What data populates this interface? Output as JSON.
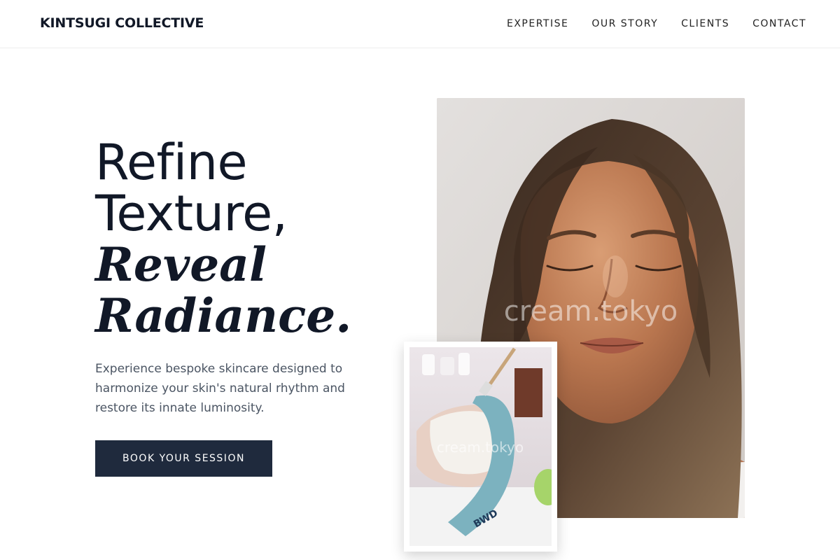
{
  "brand": "KINTSUGI COLLECTIVE",
  "nav": [
    "EXPERTISE",
    "OUR STORY",
    "CLIENTS",
    "CONTACT"
  ],
  "hero": {
    "line1": "Refine",
    "line2": "Texture,",
    "line3": "Reveal",
    "line4": "Radiance.",
    "subtitle": "Experience bespoke skincare designed to harmonize your skin's natural rhythm and restore its innate luminosity.",
    "cta": "BOOK YOUR SESSION"
  },
  "images": {
    "main_watermark": "cream.tokyo",
    "inset_watermark": "cream.tokyo",
    "headband_text": "BWD"
  },
  "colors": {
    "navy": "#1f2a3d",
    "text": "#111827",
    "muted": "#4b5563"
  }
}
